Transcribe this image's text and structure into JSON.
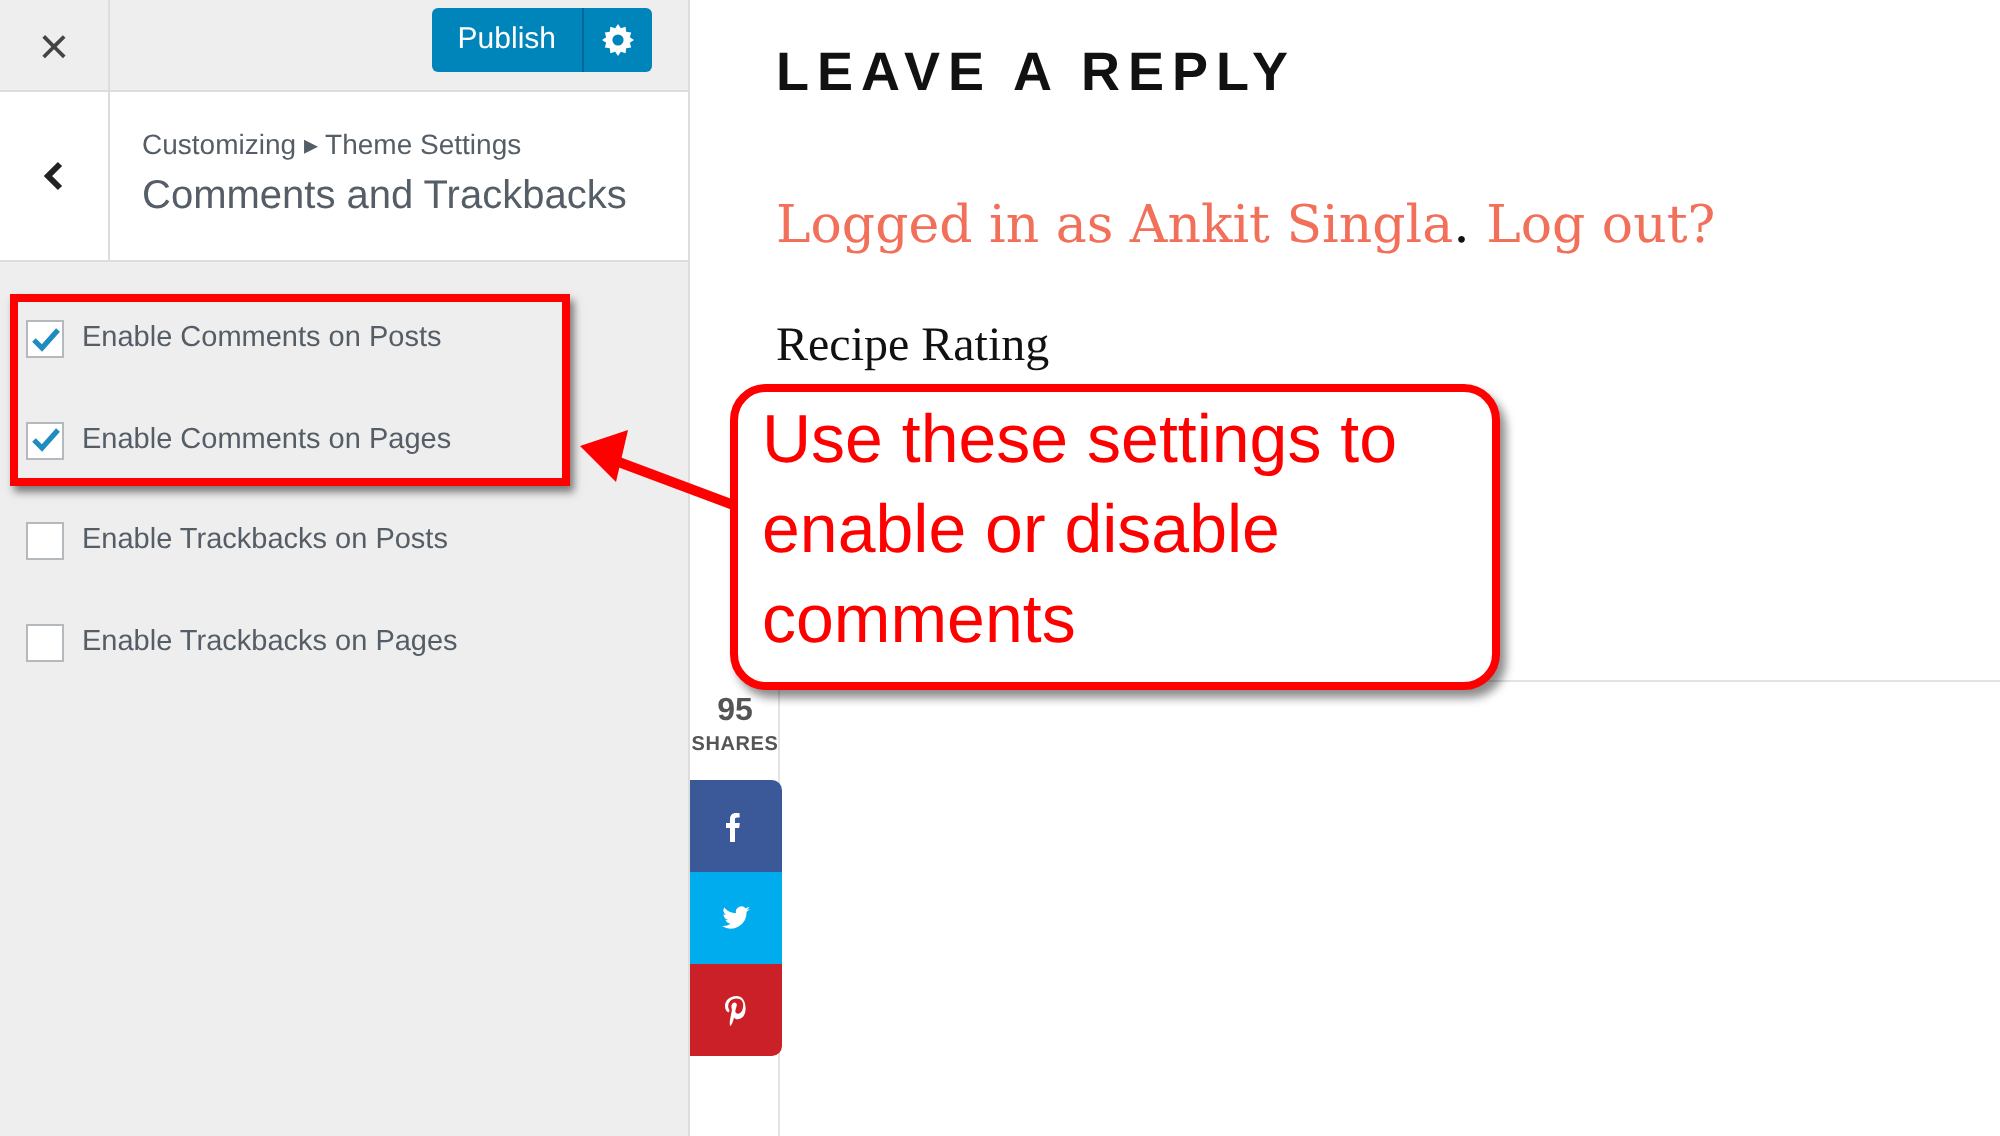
{
  "sidebar": {
    "close_label": "×",
    "publish_button": "Publish",
    "breadcrumb": {
      "parent": "Customizing",
      "separator": "▸",
      "section": "Theme Settings"
    },
    "title": "Comments and Trackbacks",
    "options": [
      {
        "label": "Enable Comments on Posts",
        "checked": true
      },
      {
        "label": "Enable Comments on Pages",
        "checked": true
      },
      {
        "label": "Enable Trackbacks on Posts",
        "checked": false
      },
      {
        "label": "Enable Trackbacks on Pages",
        "checked": false
      }
    ]
  },
  "content": {
    "heading": "LEAVE A REPLY",
    "logged_in_link": "Logged in as Ankit Singla",
    "separator": ".",
    "logout_link": "Log out?",
    "rating_heading": "Recipe Rating",
    "share": {
      "count": "95",
      "label": "SHARES",
      "buttons": [
        {
          "kind": "facebook"
        },
        {
          "kind": "twitter"
        },
        {
          "kind": "pinterest"
        }
      ]
    }
  },
  "annotation": {
    "callout": "Use these settings to enable or disable comments"
  }
}
